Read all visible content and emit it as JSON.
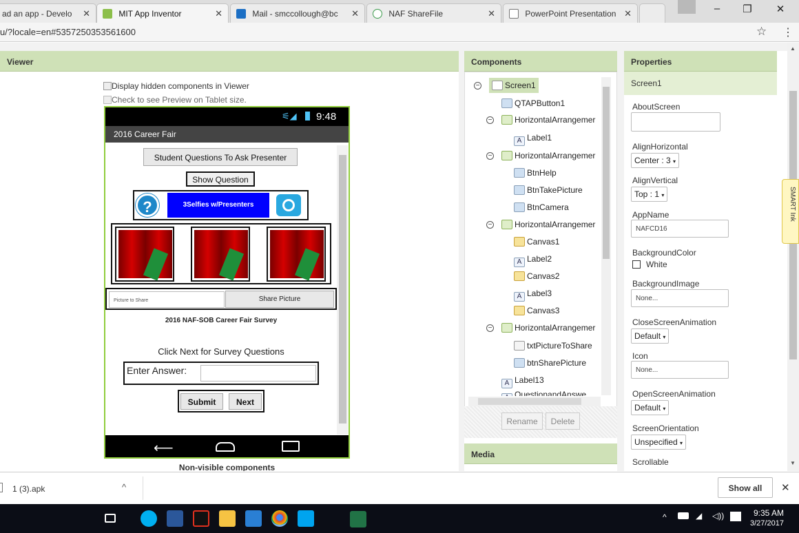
{
  "browser": {
    "tabs": [
      {
        "title": "ad an app - Develo"
      },
      {
        "title": "MIT App Inventor"
      },
      {
        "title": "Mail - smccollough@bc"
      },
      {
        "title": "NAF ShareFile"
      },
      {
        "title": "PowerPoint Presentation"
      }
    ],
    "url": "u/?locale=en#5357250353561600",
    "star": "☆",
    "menu": "⋮"
  },
  "viewer": {
    "title": "Viewer",
    "display_hidden": "Display hidden components in Viewer",
    "tablet_preview": "Check to see Preview on Tablet size.",
    "non_visible": "Non-visible components",
    "phone": {
      "time": "9:48",
      "screen_title": "2016 Career Fair",
      "btn_student_questions": "Student Questions To Ask Presenter",
      "btn_show_question": "Show Question",
      "selfies_label": "3Selfies w/Presenters",
      "picture_to_share": "Picture to Share",
      "share_picture": "Share Picture",
      "survey_title": "2016 NAF-SOB Career Fair Survey",
      "click_next": "Click Next for Survey Questions",
      "enter_answer": "Enter Answer:",
      "submit": "Submit",
      "next": "Next"
    }
  },
  "components": {
    "title": "Components",
    "tree": [
      {
        "label": "Screen1"
      },
      {
        "label": "QTAPButton1"
      },
      {
        "label": "HorizontalArrangemer"
      },
      {
        "label": "Label1"
      },
      {
        "label": "HorizontalArrangemer"
      },
      {
        "label": "BtnHelp"
      },
      {
        "label": "BtnTakePicture"
      },
      {
        "label": "BtnCamera"
      },
      {
        "label": "HorizontalArrangemer"
      },
      {
        "label": "Canvas1"
      },
      {
        "label": "Label2"
      },
      {
        "label": "Canvas2"
      },
      {
        "label": "Label3"
      },
      {
        "label": "Canvas3"
      },
      {
        "label": "HorizontalArrangemer"
      },
      {
        "label": "txtPictureToShare"
      },
      {
        "label": "btnSharePicture"
      },
      {
        "label": "Label13"
      },
      {
        "label": "QuestionandAnswe"
      }
    ],
    "rename": "Rename",
    "delete": "Delete",
    "media": "Media"
  },
  "properties": {
    "title": "Properties",
    "component": "Screen1",
    "about_screen": "AboutScreen",
    "align_horizontal": "AlignHorizontal",
    "align_horizontal_value": "Center : 3",
    "align_vertical": "AlignVertical",
    "align_vertical_value": "Top : 1",
    "app_name": "AppName",
    "app_name_value": "NAFCD16",
    "background_color": "BackgroundColor",
    "background_color_value": "White",
    "background_image": "BackgroundImage",
    "background_image_value": "None...",
    "close_screen_animation": "CloseScreenAnimation",
    "close_screen_animation_value": "Default",
    "icon": "Icon",
    "icon_value": "None...",
    "open_screen_animation": "OpenScreenAnimation",
    "open_screen_animation_value": "Default",
    "screen_orientation": "ScreenOrientation",
    "screen_orientation_value": "Unspecified",
    "scrollable": "Scrollable"
  },
  "smart_ink": "SMART Ink",
  "downloads": {
    "file": "1 (3).apk",
    "show_all": "Show all"
  },
  "taskbar": {
    "time": "9:35 AM",
    "date": "3/27/2017"
  },
  "colors": {
    "panel_header": "#cfe1b7",
    "phone_border": "#8fcc3a",
    "selfies_blue": "#0000ff",
    "taskbar": "#0b0d16"
  }
}
